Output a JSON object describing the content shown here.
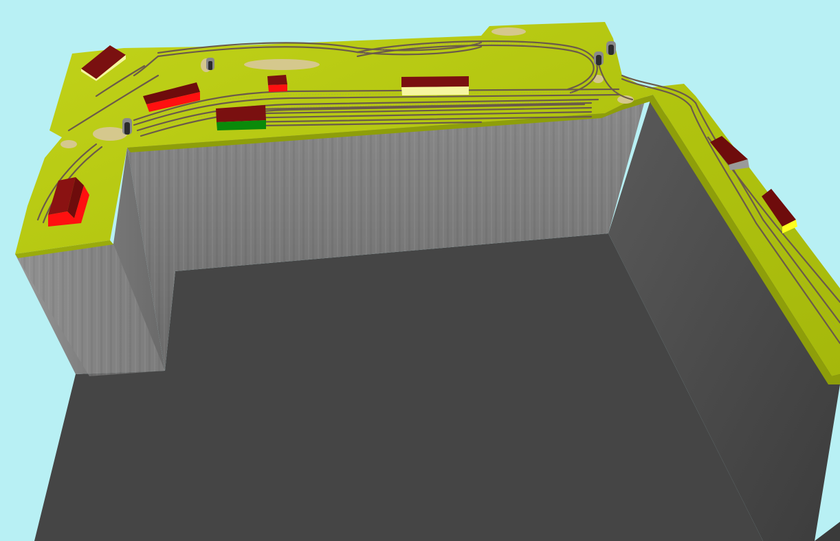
{
  "viewer": {
    "background_color": "#b8f0f4",
    "view": "3d-perspective"
  },
  "layout_model": {
    "terrain_color": "#b4c612",
    "terrain_highlight_color": "#cbd81e",
    "terrain_shadow_color": "#8e9e0a",
    "rock_color": "#d8c89a",
    "track_rail_color": "#6b5a4a",
    "track_tie_color": "#9a8a7a",
    "floor_color": "#464646",
    "wall_face_color": "#7d7d7d",
    "wall_side_color": "#4a4a4a",
    "tunnel_portals": [
      {
        "name": "portal-west",
        "color": "#8a8a8a"
      },
      {
        "name": "portal-north-a",
        "color": "#8a8a8a"
      },
      {
        "name": "portal-north-b",
        "color": "#8a8a8a"
      },
      {
        "name": "portal-hill",
        "color": "#8a8a8a"
      }
    ],
    "buildings": [
      {
        "name": "shed-northwest",
        "roof_color": "#7a1010",
        "wall_color": "#f6f6a0"
      },
      {
        "name": "station-left",
        "roof_color": "#6e0c0c",
        "wall_color": "#ff1010"
      },
      {
        "name": "small-hut",
        "roof_color": "#7a1010",
        "wall_color": "#ff1010"
      },
      {
        "name": "goods-shed-center",
        "roof_color": "#7a1010",
        "wall_color": "#0a8a0a"
      },
      {
        "name": "station-main",
        "roof_color": "#7a1010",
        "wall_color": "#f6f6a0"
      },
      {
        "name": "engine-shed-west",
        "roof_color": "#7a1010",
        "wall_color": "#ff1010"
      },
      {
        "name": "house-east-upper",
        "roof_color": "#6e0c0c",
        "wall_color": "#9a9a9a"
      },
      {
        "name": "house-east-lower",
        "roof_color": "#6e0c0c",
        "wall_color": "#ffff20"
      }
    ]
  }
}
